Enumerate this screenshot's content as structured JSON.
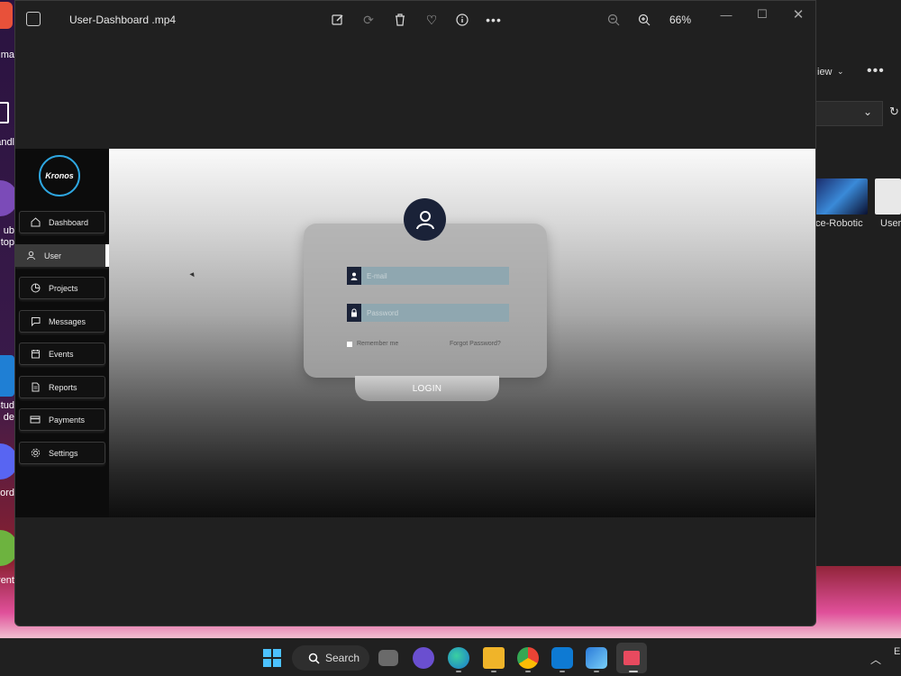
{
  "desktop": {
    "labels": [
      "ma",
      "andl",
      "ub",
      "top",
      "Stud",
      "de",
      "ord",
      "rent"
    ]
  },
  "explorer": {
    "view_label": "iew",
    "thumbs": [
      "ce-Robotic",
      "User-"
    ]
  },
  "player": {
    "title": "User-Dashboard .mp4",
    "zoom": "66%"
  },
  "app": {
    "logo_text": "Kronos",
    "nav": [
      {
        "label": "Dashboard",
        "icon": "home-icon"
      },
      {
        "label": "User",
        "icon": "user-icon"
      },
      {
        "label": "Projects",
        "icon": "pie-chart-icon"
      },
      {
        "label": "Messages",
        "icon": "message-icon"
      },
      {
        "label": "Events",
        "icon": "calendar-icon"
      },
      {
        "label": "Reports",
        "icon": "document-icon"
      },
      {
        "label": "Payments",
        "icon": "credit-card-icon"
      },
      {
        "label": "Settings",
        "icon": "gear-icon"
      }
    ],
    "active_nav": "User",
    "login": {
      "email_placeholder": "E-mail",
      "password_placeholder": "Password",
      "remember_label": "Remember me",
      "forgot_label": "Forgot Password?",
      "button_label": "LOGIN"
    }
  },
  "taskbar": {
    "search_label": "Search",
    "tray_text": "E"
  },
  "colors": {
    "accent_navy": "#1a2238",
    "logo_ring": "#2ea6e0",
    "input_fill": "#8fa7b0"
  }
}
